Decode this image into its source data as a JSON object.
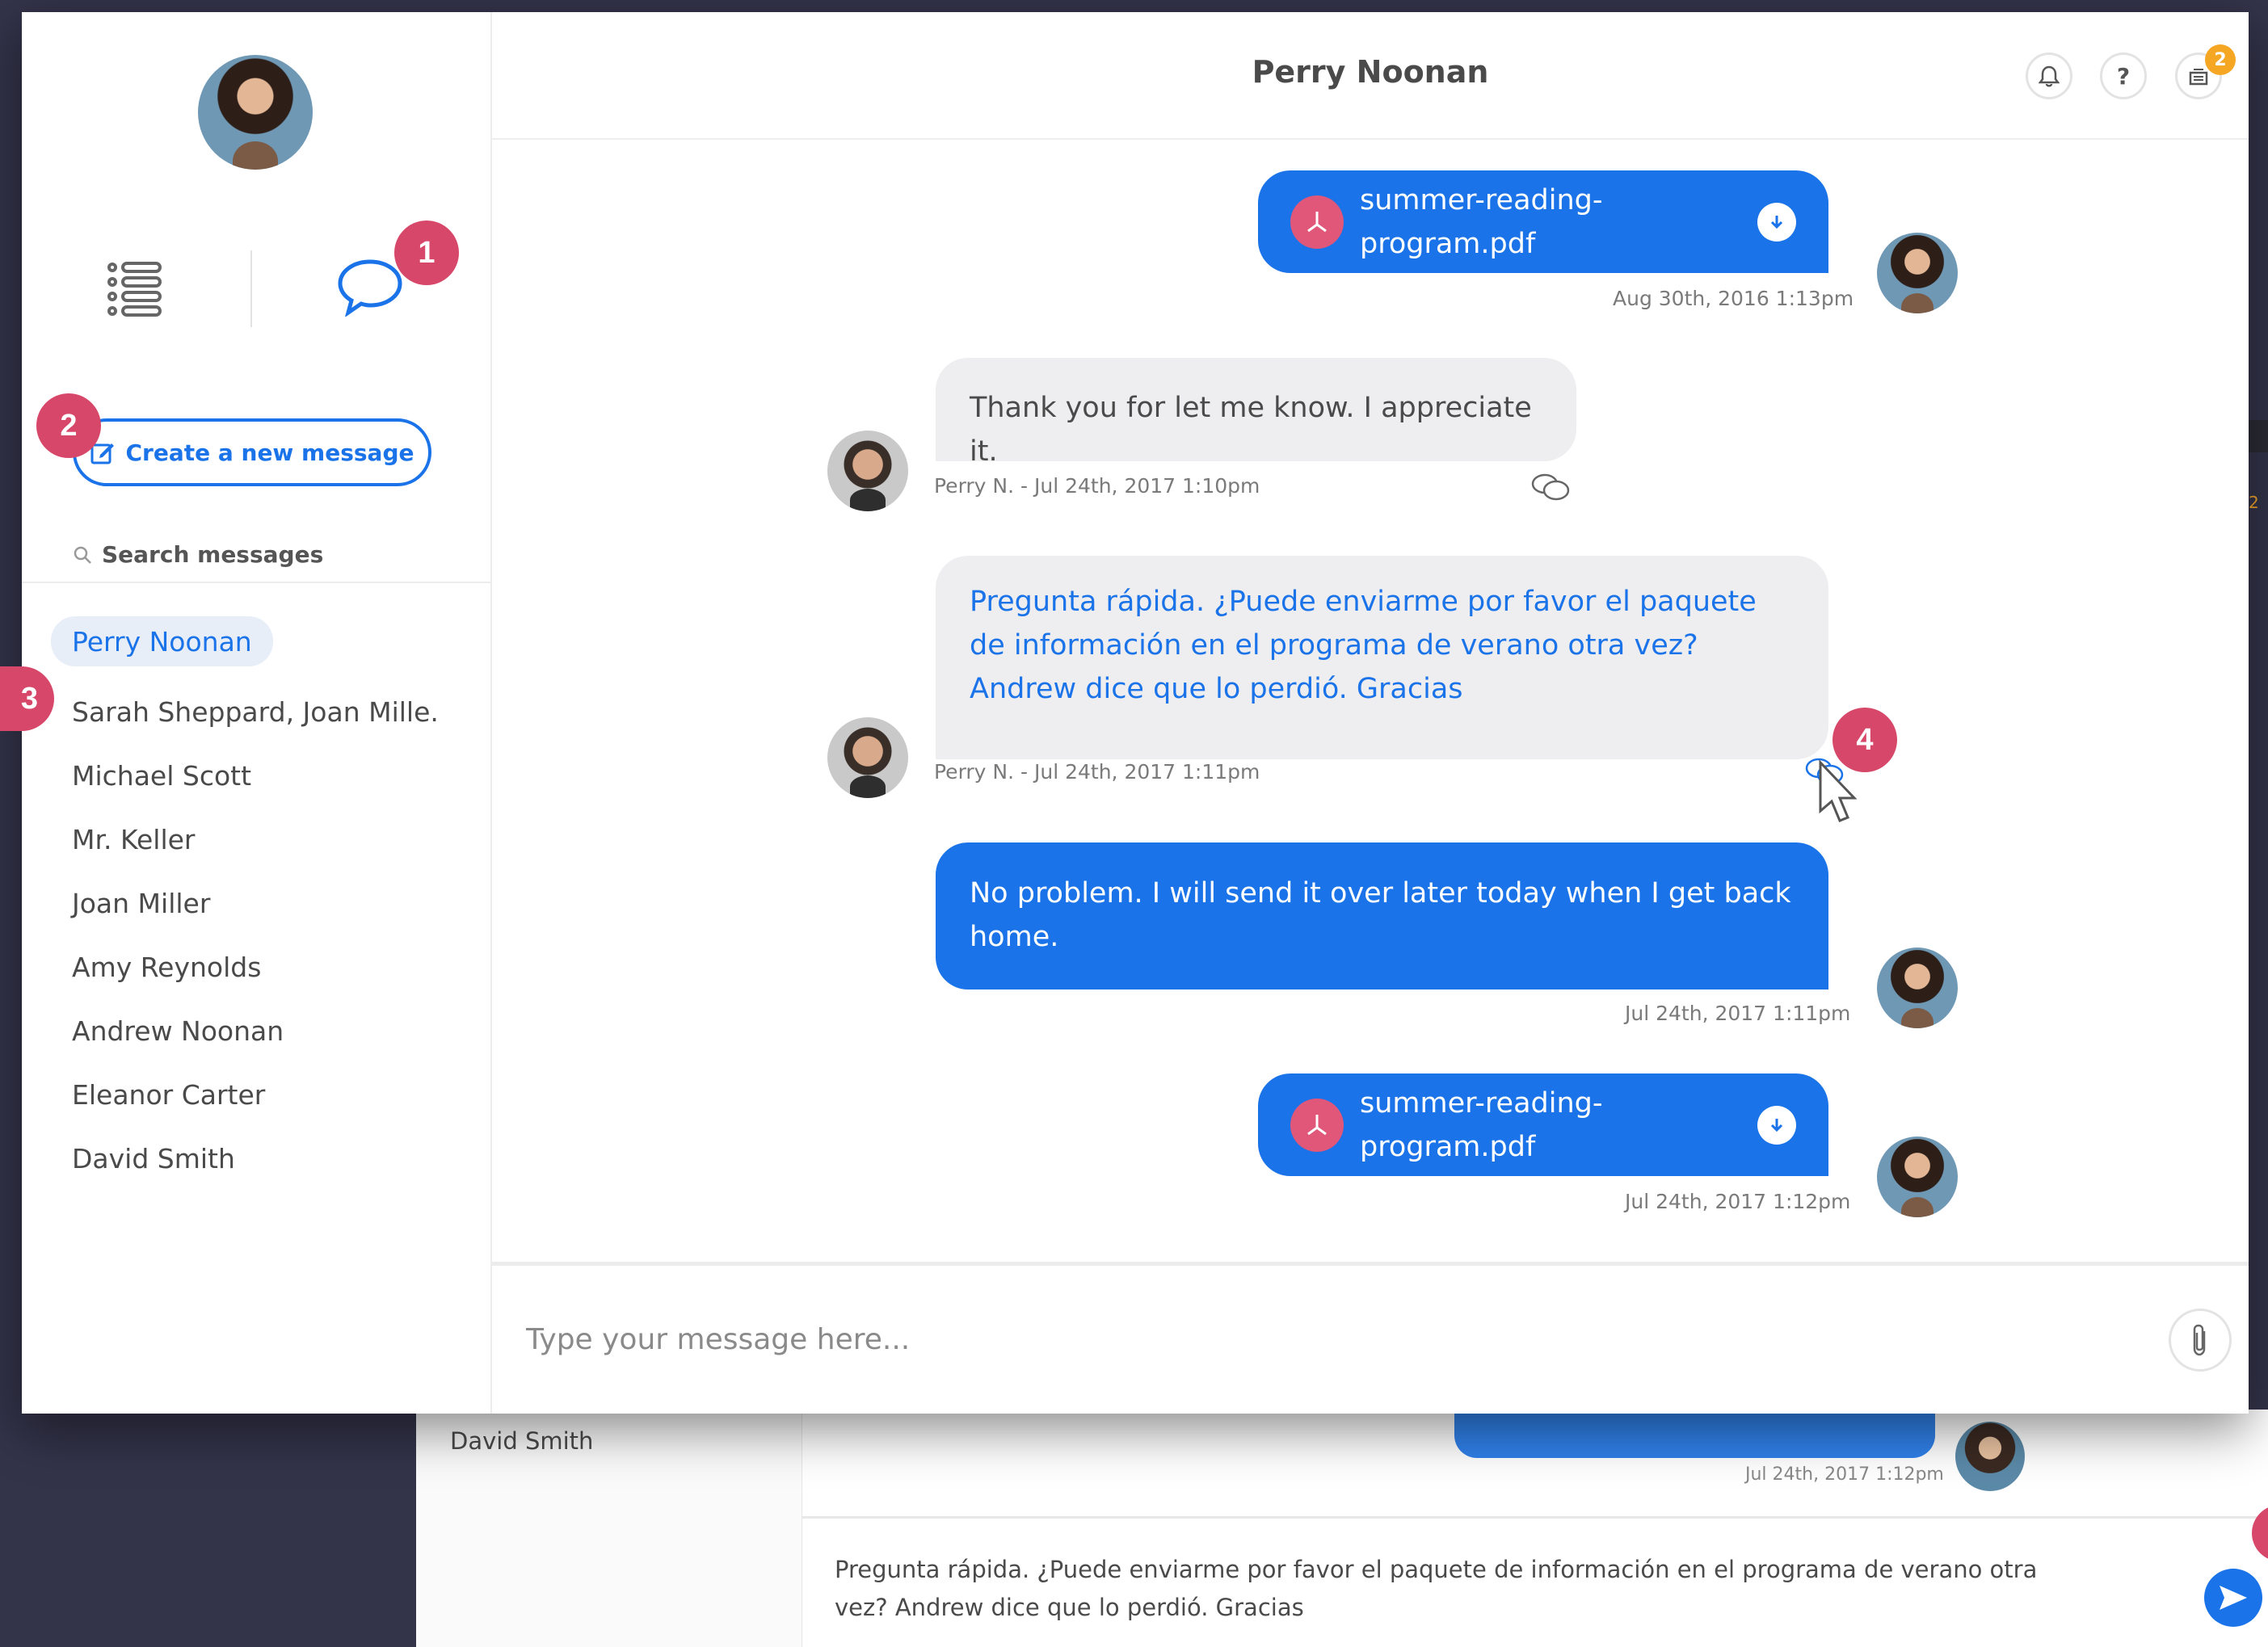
{
  "profile": {
    "avatar": "user-avatar"
  },
  "sidebar": {
    "tutorial_badges": [
      "1",
      "2",
      "3"
    ],
    "create_button": "Create a new message",
    "search_placeholder": "Search messages",
    "contacts": [
      "Perry Noonan",
      "Sarah Sheppard, Joan Mille.",
      "Michael Scott",
      "Mr. Keller",
      "Joan Miller",
      "Amy Reynolds",
      "Andrew Noonan",
      "Eleanor Carter",
      "David Smith"
    ]
  },
  "header": {
    "title": "Perry Noonan",
    "help_label": "?",
    "inbox_count": "2"
  },
  "messages": [
    {
      "type": "file",
      "direction": "out",
      "filename": "summer-reading-program.pdf",
      "meta": "Aug 30th, 2016 1:13pm"
    },
    {
      "type": "text",
      "direction": "in",
      "text": "Thank you for let me know. I appreciate it.",
      "meta": "Perry N. - Jul 24th, 2017 1:10pm"
    },
    {
      "type": "text",
      "direction": "in",
      "text": "Pregunta rápida. ¿Puede enviarme por favor el paquete de información en el programa de verano otra vez? Andrew dice que lo perdió. Gracias",
      "meta": "Perry N. - Jul 24th, 2017 1:11pm",
      "badge": "4"
    },
    {
      "type": "text",
      "direction": "out",
      "text": "No problem. I will send it over later today when I get back home.",
      "meta": "Jul 24th, 2017 1:11pm"
    },
    {
      "type": "file",
      "direction": "out",
      "filename": "summer-reading-program.pdf",
      "meta": "Jul 24th, 2017 1:12pm"
    }
  ],
  "composer": {
    "placeholder": "Type your message here..."
  },
  "background_window": {
    "contact": "David Smith",
    "time": "Jul 24th, 2017 1:12pm",
    "draft": "Pregunta rápida. ¿Puede enviarme por favor el paquete de información en el programa de verano otra vez? Andrew dice que lo perdió. Gracias",
    "side_count": "2"
  },
  "colors": {
    "accent": "#1a73e8",
    "badge": "#d7476a",
    "pdf": "#e0577a",
    "notify": "#f5a623"
  }
}
